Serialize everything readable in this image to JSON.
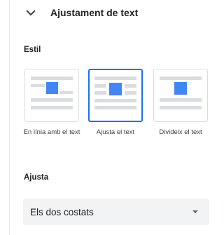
{
  "section": {
    "title": "Ajustament de text",
    "icon": "chevron-down-icon"
  },
  "style_section": {
    "label": "Estil",
    "options": [
      {
        "label": "En línia amb el text",
        "selected": false,
        "icon": "inline-with-text-icon"
      },
      {
        "label": "Ajusta el text",
        "selected": true,
        "icon": "wrap-text-icon"
      },
      {
        "label": "Divideix el text",
        "selected": false,
        "icon": "break-text-icon"
      }
    ]
  },
  "wrap_section": {
    "label": "Ajusta",
    "select_value": "Els dos costats",
    "select_icon": "caret-down-icon"
  },
  "colors": {
    "accent": "#1a73e8",
    "preview_gray": "#dadce0",
    "image_blue": "#4285f4"
  }
}
